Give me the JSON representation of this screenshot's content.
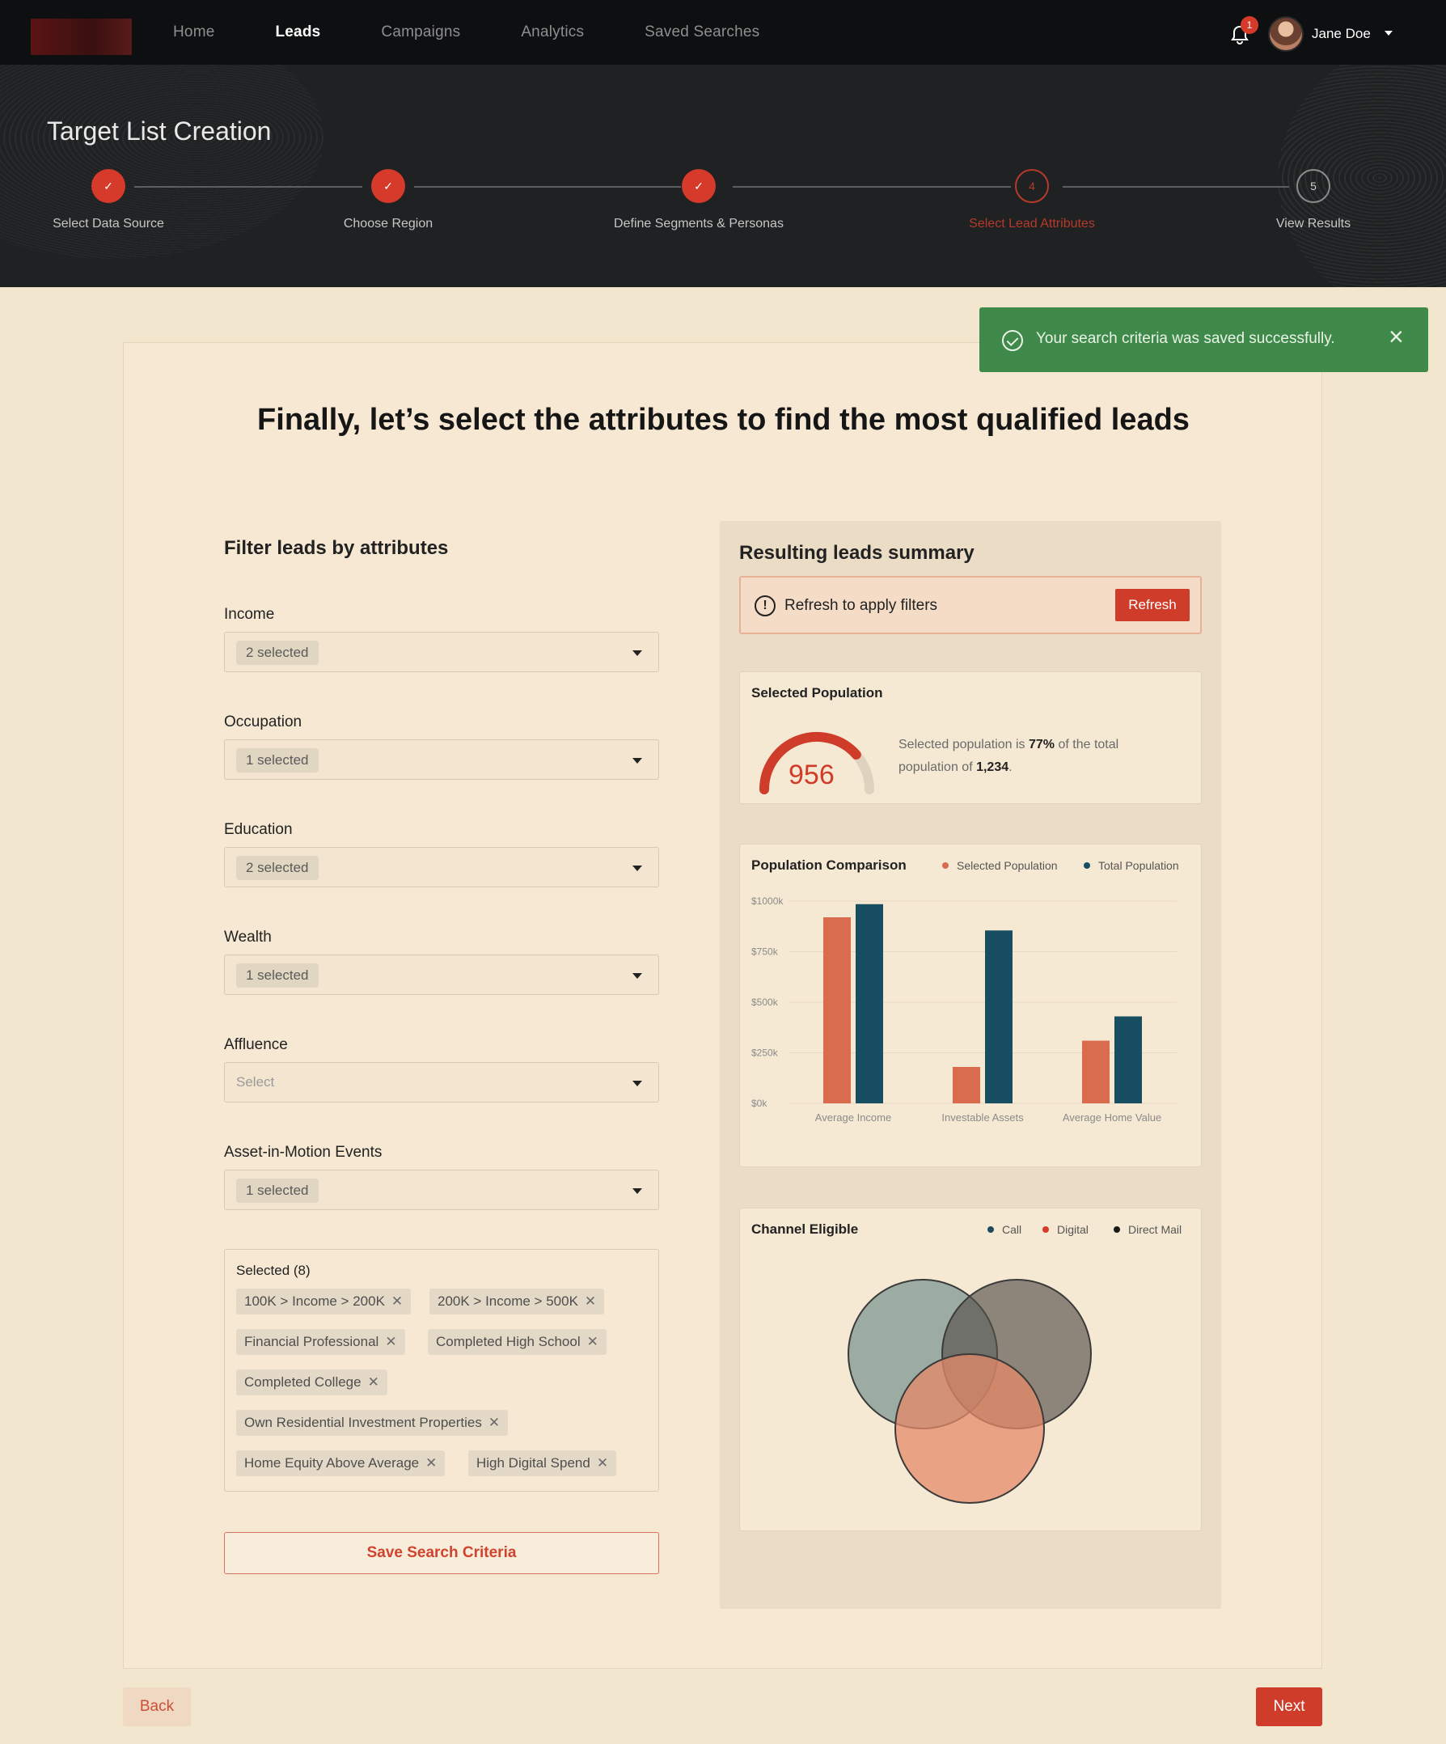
{
  "nav": {
    "links": [
      "Home",
      "Leads",
      "Campaigns",
      "Analytics",
      "Saved Searches"
    ],
    "active": "Leads",
    "notification_count": "1",
    "user_name": "Jane Doe"
  },
  "hero": {
    "title": "Target List Creation",
    "steps": [
      {
        "label": "Select Data Source",
        "status": "done",
        "marker": "✓"
      },
      {
        "label": "Choose Region",
        "status": "done",
        "marker": "✓"
      },
      {
        "label": "Define Segments & Personas",
        "status": "done",
        "marker": "✓"
      },
      {
        "label": "Select Lead Attributes",
        "status": "current",
        "marker": "4"
      },
      {
        "label": "View Results",
        "status": "todo",
        "marker": "5"
      }
    ]
  },
  "toast": {
    "message": "Your search criteria was saved successfully.",
    "close_glyph": "×"
  },
  "main": {
    "headline": "Finally, let’s select the attributes to find the most qualified leads"
  },
  "filters": {
    "title": "Filter leads by attributes",
    "fields": [
      {
        "label": "Income",
        "value": "2 selected"
      },
      {
        "label": "Occupation",
        "value": "1 selected"
      },
      {
        "label": "Education",
        "value": "2 selected"
      },
      {
        "label": "Wealth",
        "value": "1 selected"
      },
      {
        "label": "Affluence",
        "value": "",
        "placeholder": "Select"
      },
      {
        "label": "Asset-in-Motion Events",
        "value": "1 selected"
      }
    ],
    "selected_title": "Selected (8)",
    "selected_tags": [
      "100K > Income > 200K",
      "200K > Income > 500K",
      "Financial Professional",
      "Completed High School",
      "Completed College",
      "Own Residential Investment Properties",
      "Home Equity Above Average",
      "High Digital Spend"
    ],
    "save_label": "Save Search Criteria"
  },
  "summary": {
    "title": "Resulting leads summary",
    "alert_icon": "!",
    "alert_text": "Refresh to apply filters",
    "refresh_label": "Refresh",
    "population": {
      "title": "Selected Population",
      "value": "956",
      "gauge_fraction": 0.77,
      "text_pre": "Selected population is ",
      "percent": "77%",
      "text_mid": " of the total population of ",
      "total": "1,234",
      "text_post": "."
    },
    "comparison_title": "Population Comparison",
    "channel": {
      "title": "Channel Eligible",
      "legend": [
        {
          "name": "Call",
          "color": "#204a5a"
        },
        {
          "name": "Digital",
          "color": "#d63a2a"
        },
        {
          "name": "Direct Mail",
          "color": "#1a1a1a"
        }
      ]
    }
  },
  "chart_data": {
    "type": "bar",
    "title": "Population Comparison",
    "categories": [
      "Average Income",
      "Investable Assets",
      "Average Home Value"
    ],
    "series": [
      {
        "name": "Selected Population",
        "color": "#d96b4f",
        "values": [
          920,
          180,
          310
        ]
      },
      {
        "name": "Total Population",
        "color": "#174e62",
        "values": [
          985,
          855,
          430
        ]
      }
    ],
    "yticks": [
      "$0k",
      "$250k",
      "$500k",
      "$750k",
      "$1000k"
    ],
    "ylim": [
      0,
      1000
    ],
    "grid": true,
    "legend_position": "top-right"
  },
  "footer": {
    "back_label": "Back",
    "next_label": "Next"
  }
}
